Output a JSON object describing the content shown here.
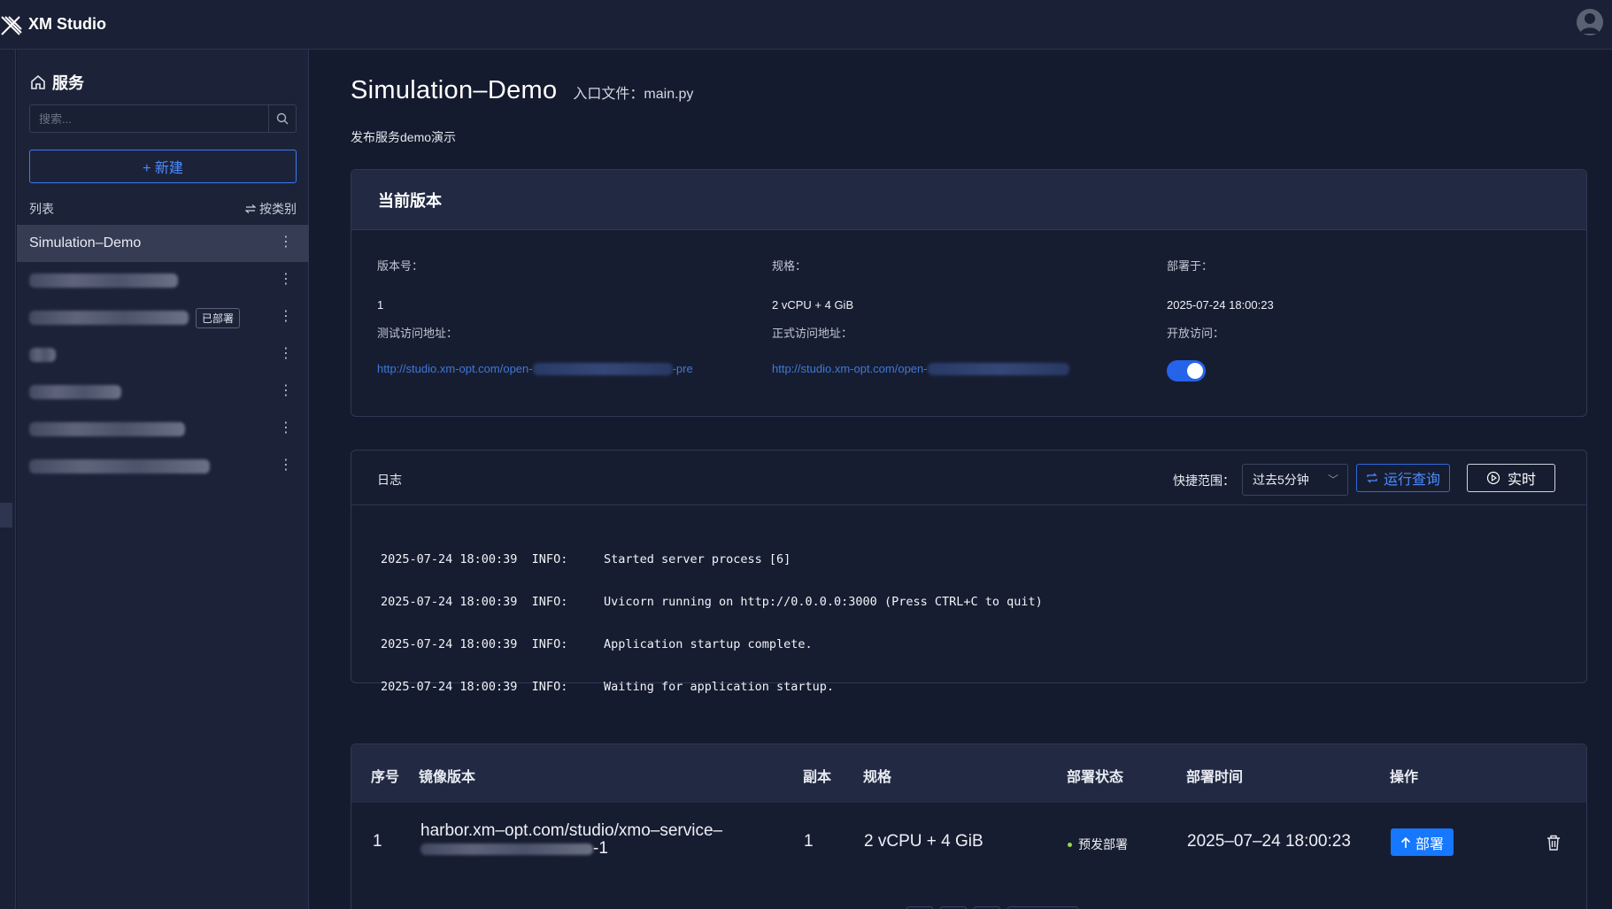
{
  "app": {
    "title": "XM Studio"
  },
  "sidebar": {
    "section_title": "服务",
    "search_placeholder": "搜索...",
    "new_label": "+ 新建",
    "list_label": "列表",
    "sort_label": "按类别",
    "items": [
      {
        "label": "Simulation–Demo",
        "active": true
      },
      {
        "label": "",
        "redacted": true
      },
      {
        "label": "",
        "redacted": true,
        "badge": "已部署"
      },
      {
        "label": "",
        "redacted": true
      },
      {
        "label": "",
        "redacted": true
      },
      {
        "label": "",
        "redacted": true
      },
      {
        "label": "",
        "redacted": true
      }
    ]
  },
  "service": {
    "name": "Simulation–Demo",
    "entry_label": "入口文件：",
    "entry_file": "main.py",
    "description": "发布服务demo演示"
  },
  "current_version": {
    "title": "当前版本",
    "version_label": "版本号：",
    "version": "1",
    "spec_label": "规格：",
    "spec": "2 vCPU + 4 GiB",
    "deployed_label": "部署于：",
    "deployed_at": "2025-07-24 18:00:23",
    "test_url_label": "测试访问地址：",
    "test_url_prefix": "http://studio.xm-opt.com/open-",
    "test_url_suffix": "-pre",
    "prod_url_label": "正式访问地址：",
    "prod_url_prefix": "http://studio.xm-opt.com/open-",
    "public_access_label": "开放访问：",
    "public_access": true
  },
  "logs": {
    "title": "日志",
    "quick_range_label": "快捷范围：",
    "range_value": "过去5分钟",
    "run_query_label": "运行查询",
    "live_label": "实时",
    "lines": [
      "2025-07-24 18:00:39  INFO:     Started server process [6]",
      "2025-07-24 18:00:39  INFO:     Uvicorn running on http://0.0.0.0:3000 (Press CTRL+C to quit)",
      "2025-07-24 18:00:39  INFO:     Application startup complete.",
      "2025-07-24 18:00:39  INFO:     Waiting for application startup."
    ]
  },
  "table": {
    "columns": [
      "序号",
      "镜像版本",
      "副本",
      "规格",
      "部署状态",
      "部署时间",
      "操作"
    ],
    "rows": [
      {
        "index": "1",
        "image_line1": "harbor.xm–opt.com/studio/xmo–service–",
        "image_suffix": "-1",
        "replicas": "1",
        "spec": "2 vCPU + 4 GiB",
        "status": "预发部署",
        "deployed_at": "2025–07–24 18:00:23",
        "action": "部署"
      }
    ]
  },
  "colors": {
    "accent": "#1677ff",
    "background": "#151b2e",
    "status_dot": "#9bd54a"
  }
}
